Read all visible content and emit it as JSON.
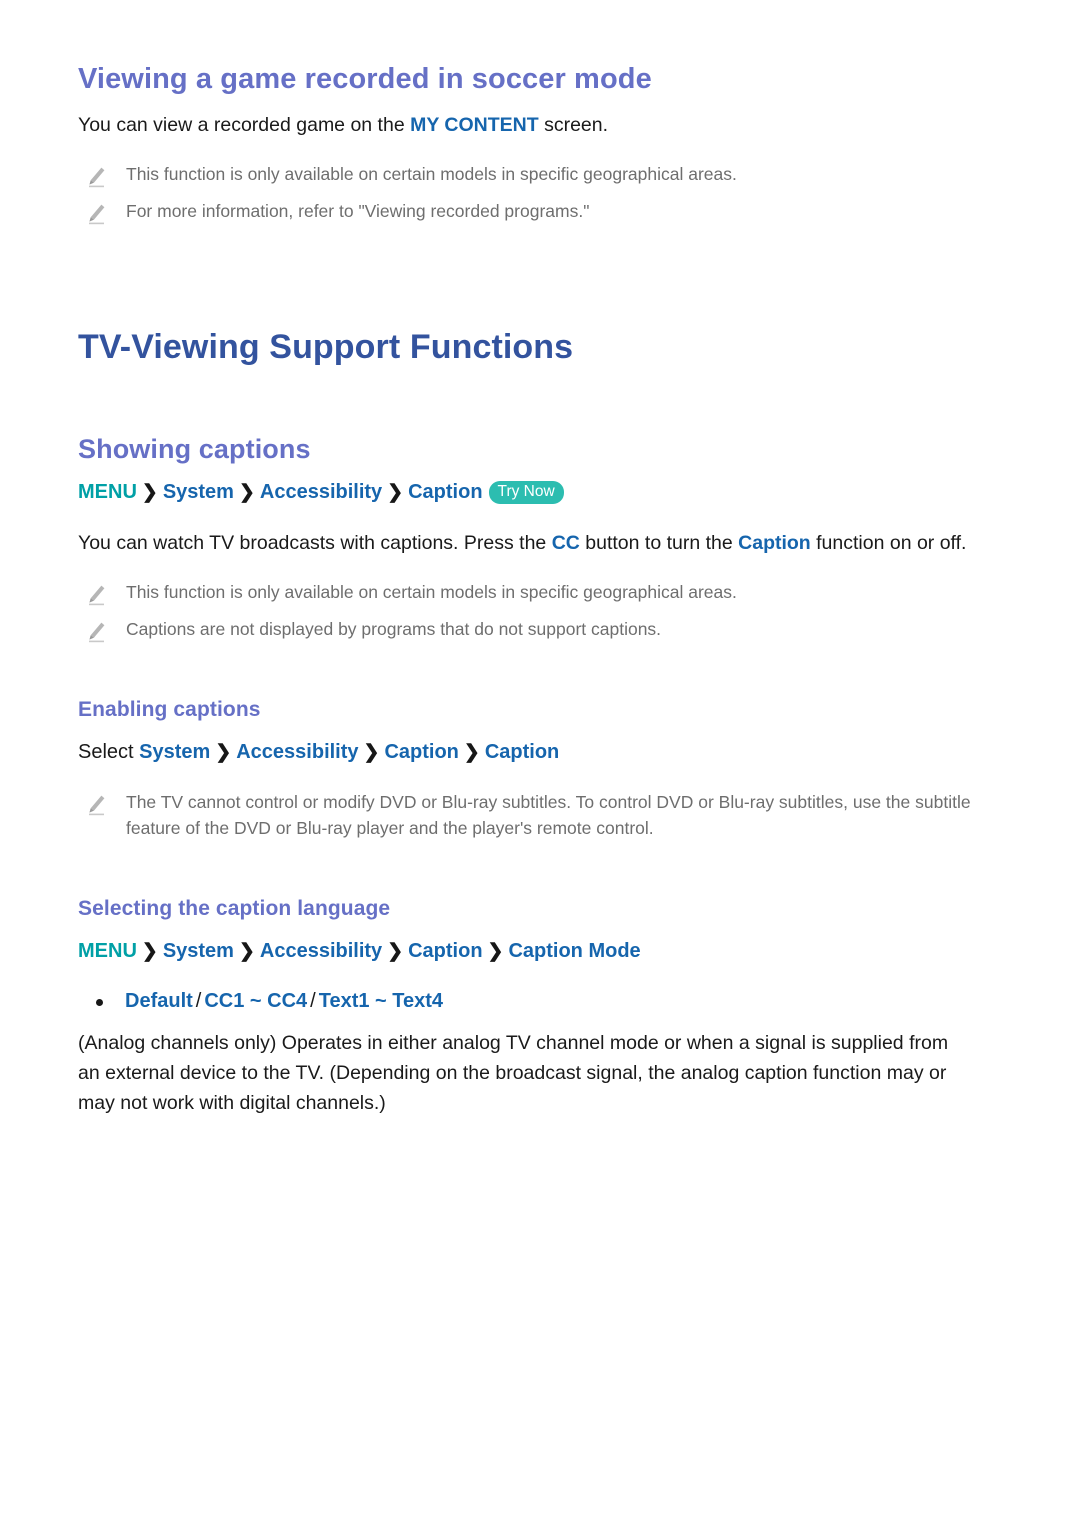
{
  "document": {
    "topic": {
      "title": "Viewing a game recorded in soccer mode",
      "intro_prefix": "You can view a recorded game on the ",
      "intro_keyword": "MY CONTENT",
      "intro_suffix": " screen.",
      "notes": [
        "This function is only available on certain models in specific geographical areas.",
        "For more information, refer to \"Viewing recorded programs.\""
      ]
    },
    "chapter": {
      "title": "TV-Viewing Support Functions"
    },
    "section": {
      "title": "Showing captions",
      "path": {
        "root": "MENU",
        "segments": [
          "System",
          "Accessibility",
          "Caption"
        ],
        "separator": "❯",
        "badge": "Try Now"
      },
      "body_part1": "You can watch TV broadcasts with captions. Press the ",
      "body_kw1": "CC",
      "body_part2": " button to turn the ",
      "body_kw2": "Caption",
      "body_part3": " function on or off.",
      "notes": [
        "This function is only available on certain models in specific geographical areas.",
        "Captions are not displayed by programs that do not support captions."
      ]
    },
    "subsection_enabling": {
      "title": "Enabling captions",
      "path": {
        "lead": "Select ",
        "segments": [
          "System",
          "Accessibility",
          "Caption",
          "Caption"
        ],
        "separator": "❯"
      },
      "notes": [
        "The TV cannot control or modify DVD or Blu-ray subtitles. To control DVD or Blu-ray subtitles, use the subtitle feature of the DVD or Blu-ray player and the player's remote control."
      ]
    },
    "subsection_language": {
      "title": "Selecting the caption language",
      "path": {
        "root": "MENU",
        "segments": [
          "System",
          "Accessibility",
          "Caption",
          "Caption Mode"
        ],
        "separator": "❯"
      },
      "options": {
        "option1": "Default",
        "slash1": "/",
        "option2": "CC1 ~ CC4",
        "slash2": "/",
        "option3": "Text1 ~ Text4"
      },
      "description": "(Analog channels only) Operates in either analog TV channel mode or when a signal is supplied from an external device to the TV. (Depending on the broadcast signal, the analog caption function may or may not work with digital channels.)"
    },
    "colors": {
      "heading_purple": "#6670c6",
      "chapter_navy": "#33539e",
      "keyword_blue": "#1665ad",
      "menu_teal": "#00a0a6",
      "badge_teal": "#2cbdb0",
      "note_gray": "#6e6e6e",
      "body_black": "#1a1a1a"
    }
  }
}
